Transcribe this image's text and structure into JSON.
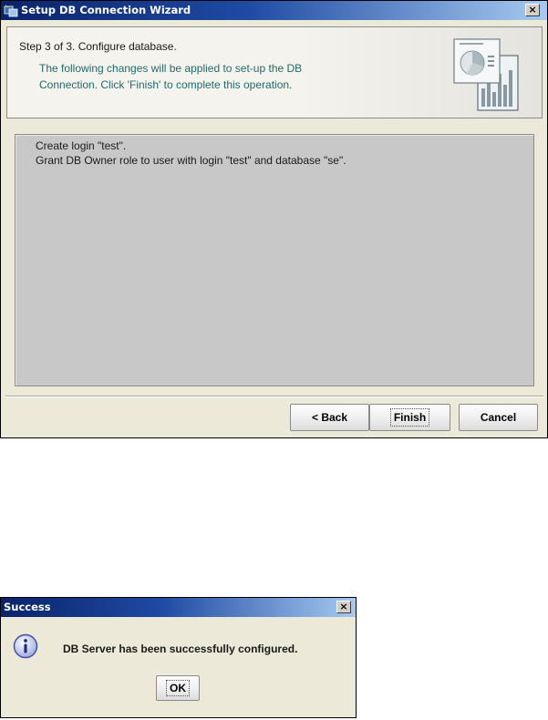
{
  "wizard": {
    "title": "Setup DB Connection Wizard",
    "close_label": "×",
    "step": "Step 3 of 3. Configure database.",
    "description": "The following changes will be applied to set-up the DB Connection. Click 'Finish' to complete this operation.",
    "changes": [
      "Create login \"test\".",
      "Grant DB Owner role to user with login \"test\" and database \"se\"."
    ],
    "buttons": {
      "back": "< Back",
      "finish": "Finish",
      "cancel": "Cancel"
    },
    "icons": {
      "app": "wizard-app-icon",
      "header": "chart-report-graphic"
    }
  },
  "success_dialog": {
    "title": "Success",
    "close_label": "×",
    "message": "DB Server has been successfully configured.",
    "ok_label": "OK",
    "icon": "info-icon"
  },
  "colors": {
    "titlebar_start": "#0a246a",
    "titlebar_end": "#a6caf0",
    "description_text": "#1f6b6b",
    "list_background": "#c8c8c8"
  }
}
